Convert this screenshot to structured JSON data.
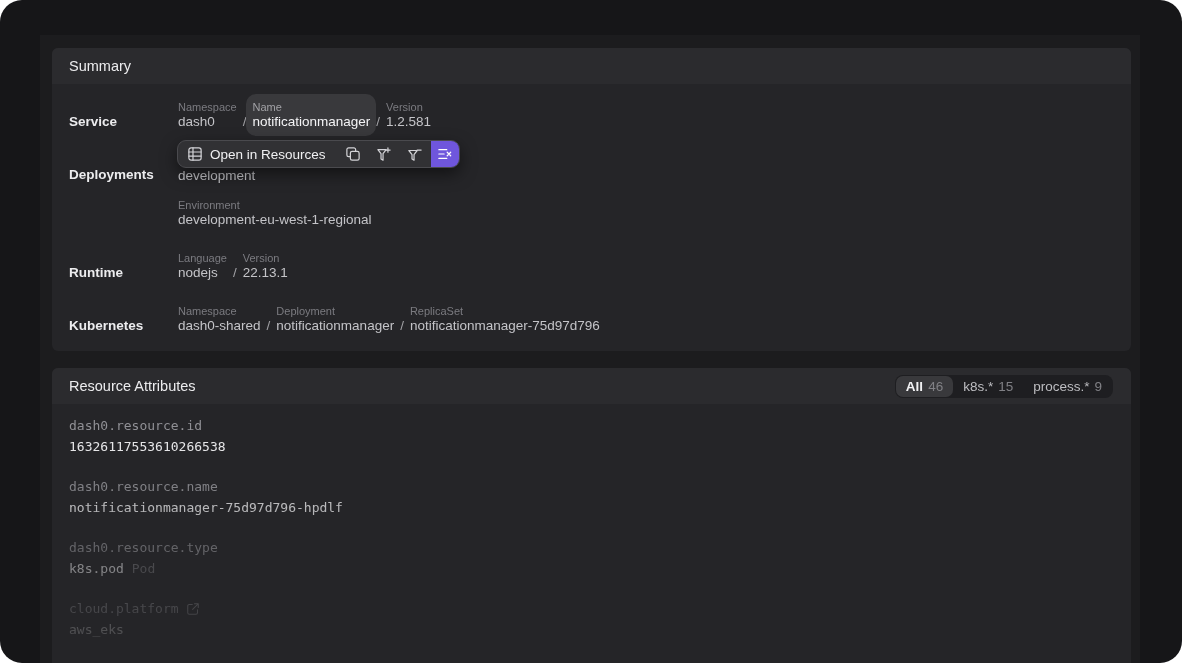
{
  "summary": {
    "title": "Summary",
    "rows": [
      {
        "label": "Service",
        "lines": [
          [
            {
              "label": "Namespace",
              "value": "dash0",
              "selected": false
            },
            {
              "separator": "/",
              "label": "Name",
              "value": "notificationmanager",
              "selected": true
            },
            {
              "separator": "/",
              "label": "Version",
              "value": "1.2.581",
              "selected": false
            }
          ]
        ]
      },
      {
        "label": "Deployments",
        "lines": [
          [
            {
              "value": "development",
              "selected": false
            }
          ],
          [
            {
              "label": "Environment",
              "value": "development-eu-west-1-regional",
              "selected": false
            }
          ]
        ]
      },
      {
        "label": "Runtime",
        "lines": [
          [
            {
              "label": "Language",
              "value": "nodejs",
              "selected": false
            },
            {
              "separator": "/",
              "label": "Version",
              "value": "22.13.1",
              "selected": false
            }
          ]
        ]
      },
      {
        "label": "Kubernetes",
        "lines": [
          [
            {
              "label": "Namespace",
              "value": "dash0-shared",
              "selected": false
            },
            {
              "separator": "/",
              "label": "Deployment",
              "value": "notificationmanager",
              "selected": false
            },
            {
              "separator": "/",
              "label": "ReplicaSet",
              "value": "notificationmanager-75d97d796",
              "selected": false
            }
          ]
        ]
      }
    ],
    "toolbar": {
      "actions": [
        {
          "kind": "table",
          "label": "Open in Resources",
          "selected": false
        },
        {
          "kind": "copy",
          "selected": false
        },
        {
          "kind": "filter-plus",
          "selected": false
        },
        {
          "kind": "filter-minus",
          "selected": false
        },
        {
          "kind": "lines-x",
          "selected": true
        }
      ]
    }
  },
  "resource_attributes": {
    "title": "Resource Attributes",
    "filters": [
      {
        "label": "All",
        "count": "46",
        "selected": true
      },
      {
        "label": "k8s.*",
        "count": "15",
        "selected": false
      },
      {
        "label": "process.*",
        "count": "9",
        "selected": false
      }
    ],
    "items": [
      {
        "key": "dash0.resource.id",
        "value": "16326117553610266538"
      },
      {
        "key": "dash0.resource.name",
        "value": "notificationmanager-75d97d796-hpdlf"
      },
      {
        "key": "dash0.resource.type",
        "value": "k8s.pod",
        "note": "Pod"
      },
      {
        "key": "cloud.platform",
        "value": "aws_eks",
        "external_link": true
      }
    ]
  }
}
